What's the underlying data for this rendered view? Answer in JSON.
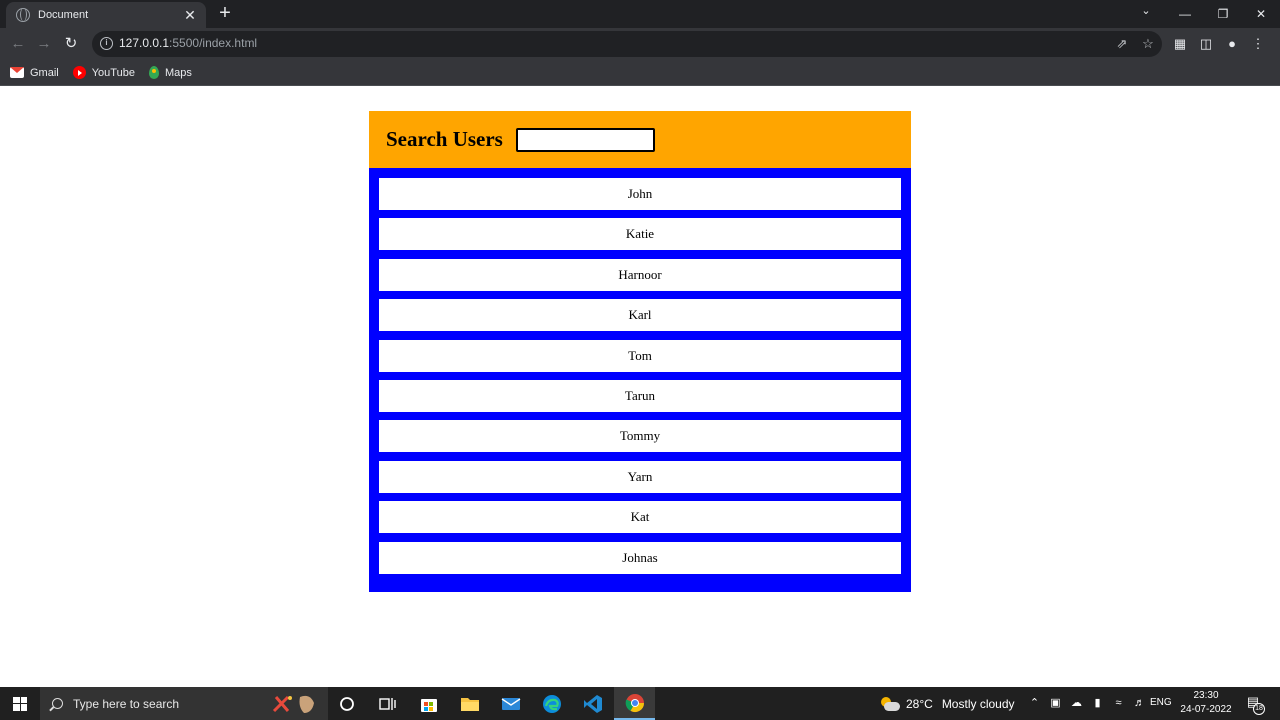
{
  "browser": {
    "tab": {
      "title": "Document",
      "close": "✕"
    },
    "new_tab": "+",
    "url_host": "127.0.0.1",
    "url_rest": ":5500/index.html",
    "bookmarks": [
      {
        "label": "Gmail",
        "icon": "gmail-icon"
      },
      {
        "label": "YouTube",
        "icon": "youtube-icon"
      },
      {
        "label": "Maps",
        "icon": "maps-icon"
      }
    ]
  },
  "page": {
    "header_title": "Search Users",
    "search_value": "",
    "users": [
      "John",
      "Katie",
      "Harnoor",
      "Karl",
      "Tom",
      "Tarun",
      "Tommy",
      "Yarn",
      "Kat",
      "Johnas"
    ],
    "colors": {
      "header_bg": "#ffa500",
      "list_bg": "#0000ff",
      "item_bg": "#ffffff"
    }
  },
  "taskbar": {
    "search_placeholder": "Type here to search",
    "weather_temp": "28°C",
    "weather_desc": "Mostly cloudy",
    "language": "ENG",
    "time": "23:30",
    "date": "24-07-2022",
    "notification_count": "18"
  }
}
